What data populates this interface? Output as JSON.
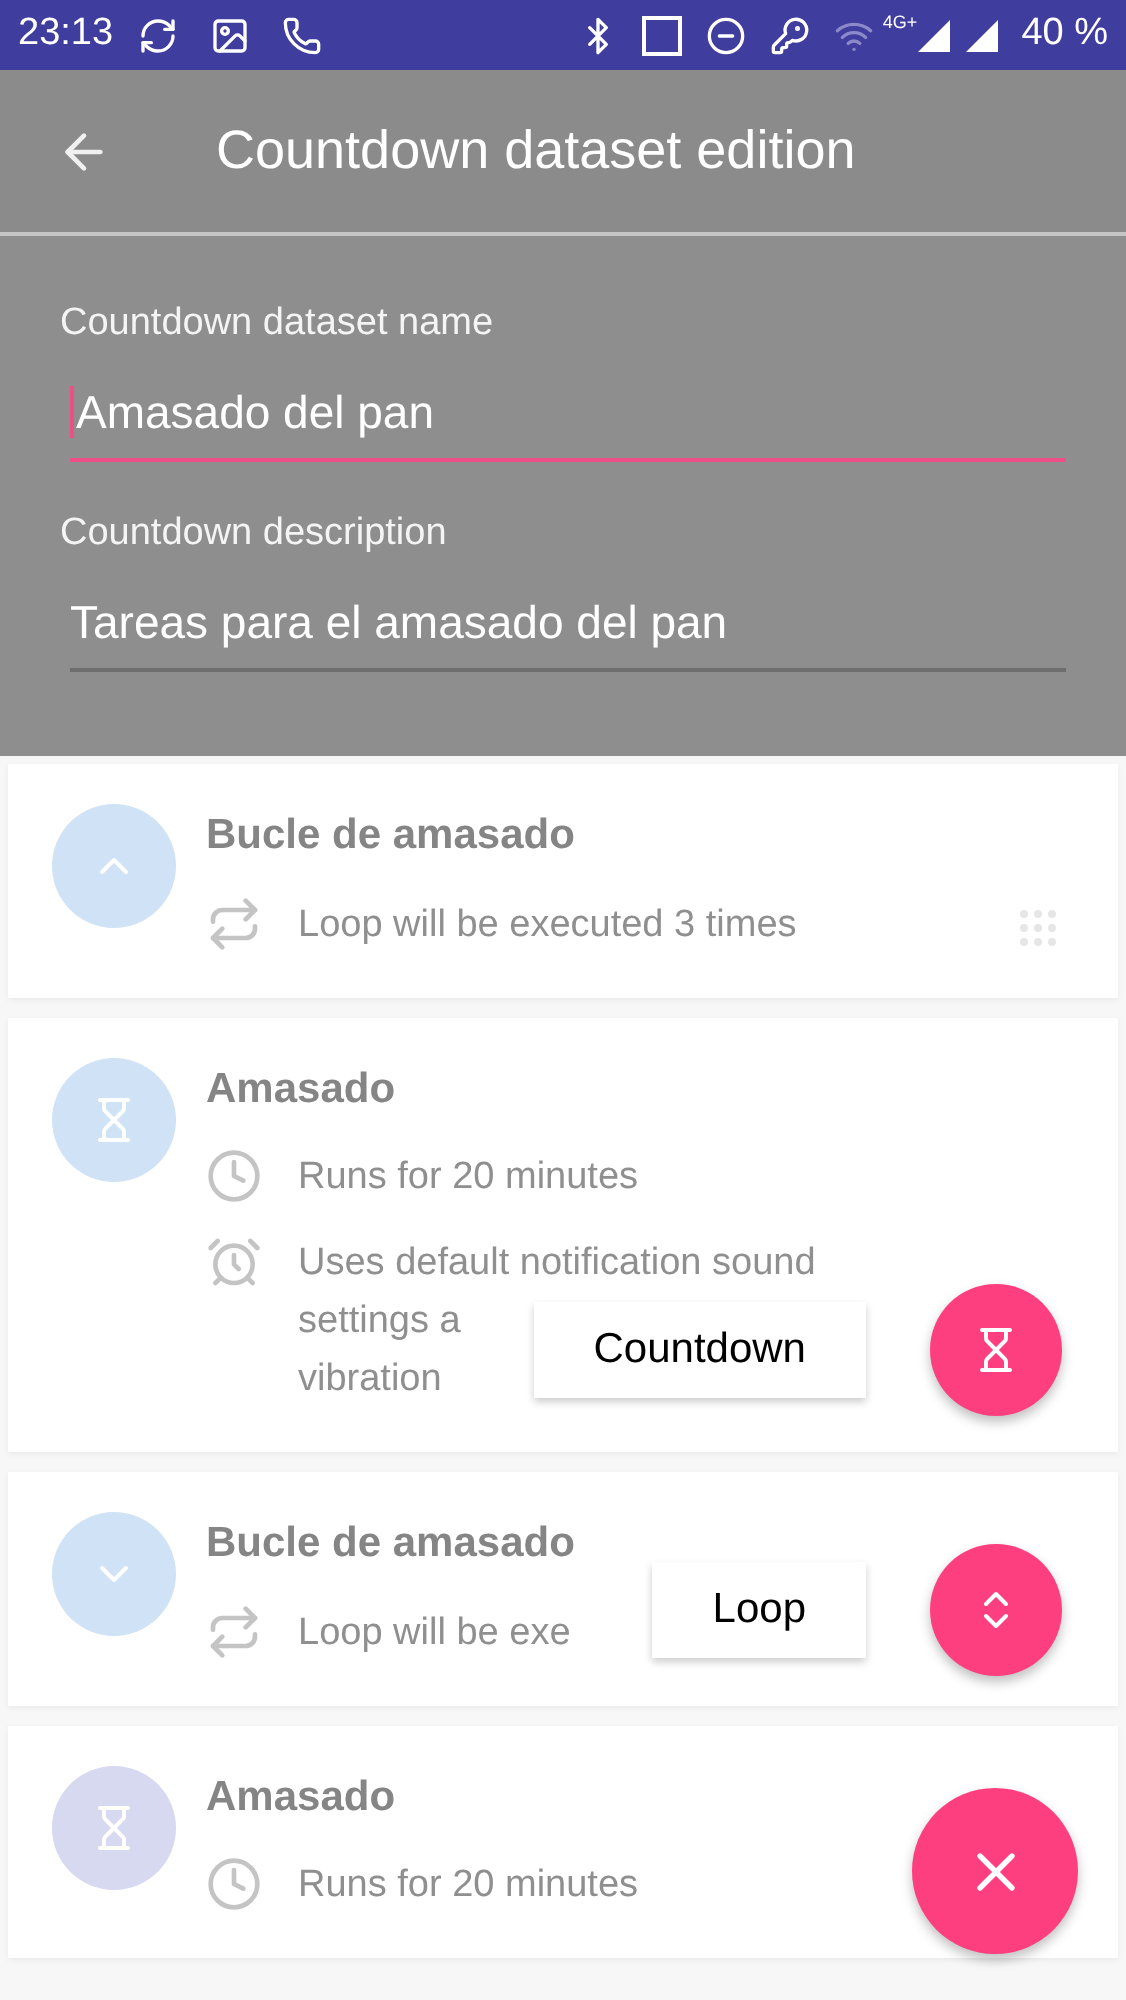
{
  "status_bar": {
    "time": "23:13",
    "network": "4G+",
    "battery": "40 %"
  },
  "app_bar": {
    "title": "Countdown dataset edition"
  },
  "form": {
    "fields": [
      {
        "label": "Countdown dataset name",
        "value": "Amasado del pan",
        "focused": true
      },
      {
        "label": "Countdown description",
        "value": "Tareas para el amasado del pan",
        "focused": false
      }
    ]
  },
  "steps": [
    {
      "kind": "loop",
      "title": "Bucle de amasado",
      "expanded": true,
      "color": "#cfe2f6",
      "details": [
        {
          "kind": "repeat",
          "lines": [
            "Loop will be executed 3 times"
          ]
        }
      ]
    },
    {
      "kind": "countdown",
      "title": "Amasado",
      "color": "#cfe2f6",
      "details": [
        {
          "kind": "time",
          "lines": [
            "Runs for 20 minutes"
          ]
        },
        {
          "kind": "alarm",
          "lines": [
            "Uses default notification sound",
            "settings a",
            "vibration"
          ]
        }
      ]
    },
    {
      "kind": "loop",
      "title": "Bucle de amasado",
      "expanded": false,
      "color": "#cfe2f6",
      "details": [
        {
          "kind": "repeat",
          "lines": [
            "Loop will be exe"
          ]
        }
      ]
    },
    {
      "kind": "countdown",
      "title": "Amasado",
      "color": "#d6d9ef",
      "details": [
        {
          "kind": "time",
          "lines": [
            "Runs for 20 minutes"
          ]
        }
      ]
    }
  ],
  "speed_dial": {
    "open": true,
    "actions": [
      {
        "kind": "countdown",
        "label": "Countdown"
      },
      {
        "kind": "loop",
        "label": "Loop"
      }
    ]
  }
}
